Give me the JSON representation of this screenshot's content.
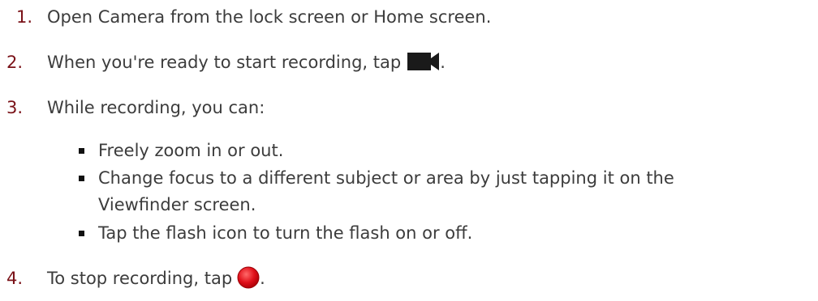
{
  "steps": [
    {
      "number": "1.",
      "text": "Open Camera from the lock screen or Home screen."
    },
    {
      "number": "2.",
      "text": "When you're ready to start recording, tap",
      "suffix": ".",
      "icon": "video-camera-icon"
    },
    {
      "number": "3.",
      "text": "While recording, you can:"
    },
    {
      "number": "4.",
      "text": "To stop recording, tap",
      "suffix": ".",
      "icon": "record-stop-icon"
    }
  ],
  "bullets": [
    {
      "line1": "Freely zoom in or out."
    },
    {
      "line1": "Change focus to a different subject or area by just tapping it on the",
      "line2": "Viewfinder screen."
    },
    {
      "line1": "Tap the flash icon to turn the flash on or off."
    }
  ],
  "colors": {
    "number": "#7a1218",
    "text": "#3c3c3c",
    "camera_icon": "#1a1a1a",
    "record_icon": "#e0101a"
  }
}
